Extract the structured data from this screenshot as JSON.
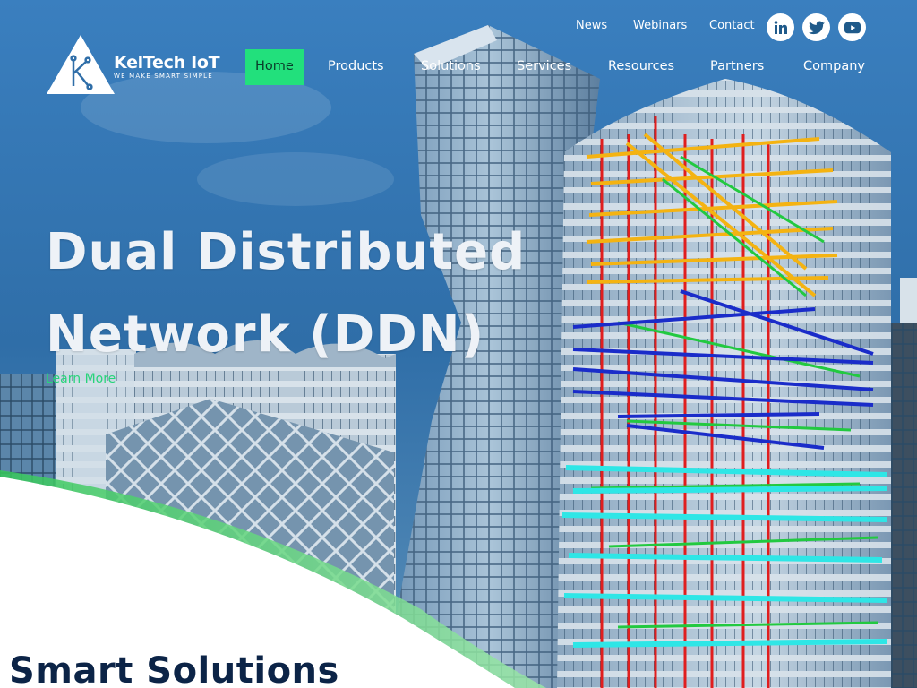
{
  "brand": {
    "name": "KelTech IoT",
    "tagline": "WE MAKE SMART SIMPLE",
    "logo_letter": "K"
  },
  "utility_nav": {
    "items": [
      "News",
      "Webinars",
      "Contact"
    ]
  },
  "social": [
    {
      "icon": "linkedin-icon",
      "glyph": "in"
    },
    {
      "icon": "twitter-icon",
      "glyph": ""
    },
    {
      "icon": "youtube-icon",
      "glyph": ""
    }
  ],
  "main_nav": {
    "items": [
      "Home",
      "Products",
      "Solutions",
      "Services",
      "Resources",
      "Partners",
      "Company"
    ],
    "active": "Home"
  },
  "hero": {
    "headline_line1": "Dual Distributed",
    "headline_line2": "Network (DDN)",
    "cta": "Learn More"
  },
  "section": {
    "title": "Smart Solutions"
  },
  "colors": {
    "accent": "#22e07c",
    "brand_navy": "#0c2447",
    "sky": "#2f6ea8",
    "social_icon": "#1f5a8a"
  }
}
